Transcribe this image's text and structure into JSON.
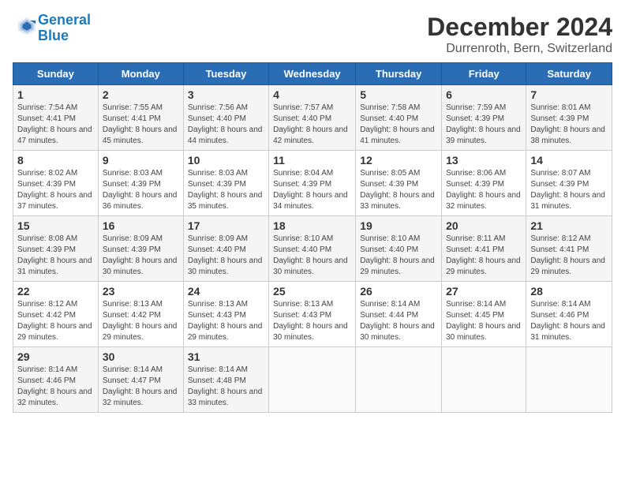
{
  "logo": {
    "line1": "General",
    "line2": "Blue"
  },
  "title": "December 2024",
  "location": "Durrenroth, Bern, Switzerland",
  "days_of_week": [
    "Sunday",
    "Monday",
    "Tuesday",
    "Wednesday",
    "Thursday",
    "Friday",
    "Saturday"
  ],
  "weeks": [
    [
      {
        "day": "1",
        "sunrise": "7:54 AM",
        "sunset": "4:41 PM",
        "daylight": "8 hours and 47 minutes."
      },
      {
        "day": "2",
        "sunrise": "7:55 AM",
        "sunset": "4:41 PM",
        "daylight": "8 hours and 45 minutes."
      },
      {
        "day": "3",
        "sunrise": "7:56 AM",
        "sunset": "4:40 PM",
        "daylight": "8 hours and 44 minutes."
      },
      {
        "day": "4",
        "sunrise": "7:57 AM",
        "sunset": "4:40 PM",
        "daylight": "8 hours and 42 minutes."
      },
      {
        "day": "5",
        "sunrise": "7:58 AM",
        "sunset": "4:40 PM",
        "daylight": "8 hours and 41 minutes."
      },
      {
        "day": "6",
        "sunrise": "7:59 AM",
        "sunset": "4:39 PM",
        "daylight": "8 hours and 39 minutes."
      },
      {
        "day": "7",
        "sunrise": "8:01 AM",
        "sunset": "4:39 PM",
        "daylight": "8 hours and 38 minutes."
      }
    ],
    [
      {
        "day": "8",
        "sunrise": "8:02 AM",
        "sunset": "4:39 PM",
        "daylight": "8 hours and 37 minutes."
      },
      {
        "day": "9",
        "sunrise": "8:03 AM",
        "sunset": "4:39 PM",
        "daylight": "8 hours and 36 minutes."
      },
      {
        "day": "10",
        "sunrise": "8:03 AM",
        "sunset": "4:39 PM",
        "daylight": "8 hours and 35 minutes."
      },
      {
        "day": "11",
        "sunrise": "8:04 AM",
        "sunset": "4:39 PM",
        "daylight": "8 hours and 34 minutes."
      },
      {
        "day": "12",
        "sunrise": "8:05 AM",
        "sunset": "4:39 PM",
        "daylight": "8 hours and 33 minutes."
      },
      {
        "day": "13",
        "sunrise": "8:06 AM",
        "sunset": "4:39 PM",
        "daylight": "8 hours and 32 minutes."
      },
      {
        "day": "14",
        "sunrise": "8:07 AM",
        "sunset": "4:39 PM",
        "daylight": "8 hours and 31 minutes."
      }
    ],
    [
      {
        "day": "15",
        "sunrise": "8:08 AM",
        "sunset": "4:39 PM",
        "daylight": "8 hours and 31 minutes."
      },
      {
        "day": "16",
        "sunrise": "8:09 AM",
        "sunset": "4:39 PM",
        "daylight": "8 hours and 30 minutes."
      },
      {
        "day": "17",
        "sunrise": "8:09 AM",
        "sunset": "4:40 PM",
        "daylight": "8 hours and 30 minutes."
      },
      {
        "day": "18",
        "sunrise": "8:10 AM",
        "sunset": "4:40 PM",
        "daylight": "8 hours and 30 minutes."
      },
      {
        "day": "19",
        "sunrise": "8:10 AM",
        "sunset": "4:40 PM",
        "daylight": "8 hours and 29 minutes."
      },
      {
        "day": "20",
        "sunrise": "8:11 AM",
        "sunset": "4:41 PM",
        "daylight": "8 hours and 29 minutes."
      },
      {
        "day": "21",
        "sunrise": "8:12 AM",
        "sunset": "4:41 PM",
        "daylight": "8 hours and 29 minutes."
      }
    ],
    [
      {
        "day": "22",
        "sunrise": "8:12 AM",
        "sunset": "4:42 PM",
        "daylight": "8 hours and 29 minutes."
      },
      {
        "day": "23",
        "sunrise": "8:13 AM",
        "sunset": "4:42 PM",
        "daylight": "8 hours and 29 minutes."
      },
      {
        "day": "24",
        "sunrise": "8:13 AM",
        "sunset": "4:43 PM",
        "daylight": "8 hours and 29 minutes."
      },
      {
        "day": "25",
        "sunrise": "8:13 AM",
        "sunset": "4:43 PM",
        "daylight": "8 hours and 30 minutes."
      },
      {
        "day": "26",
        "sunrise": "8:14 AM",
        "sunset": "4:44 PM",
        "daylight": "8 hours and 30 minutes."
      },
      {
        "day": "27",
        "sunrise": "8:14 AM",
        "sunset": "4:45 PM",
        "daylight": "8 hours and 30 minutes."
      },
      {
        "day": "28",
        "sunrise": "8:14 AM",
        "sunset": "4:46 PM",
        "daylight": "8 hours and 31 minutes."
      }
    ],
    [
      {
        "day": "29",
        "sunrise": "8:14 AM",
        "sunset": "4:46 PM",
        "daylight": "8 hours and 32 minutes."
      },
      {
        "day": "30",
        "sunrise": "8:14 AM",
        "sunset": "4:47 PM",
        "daylight": "8 hours and 32 minutes."
      },
      {
        "day": "31",
        "sunrise": "8:14 AM",
        "sunset": "4:48 PM",
        "daylight": "8 hours and 33 minutes."
      },
      null,
      null,
      null,
      null
    ]
  ]
}
